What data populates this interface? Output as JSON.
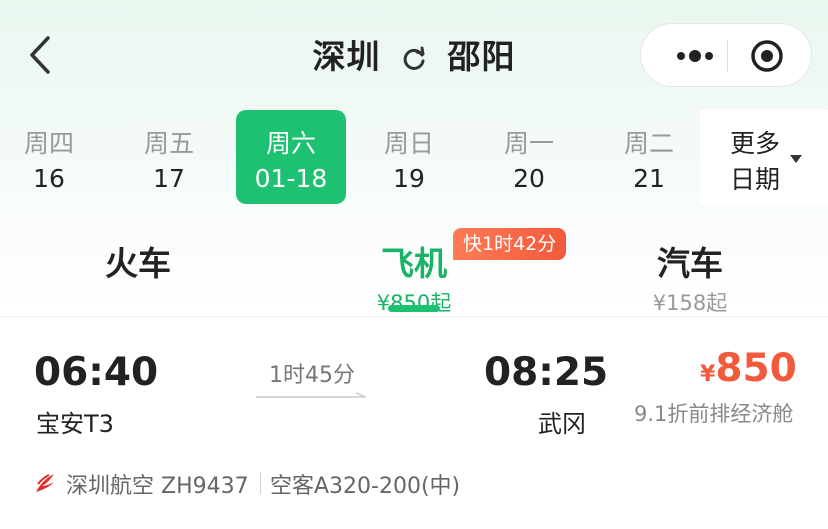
{
  "header": {
    "from_city": "深圳",
    "to_city": "邵阳"
  },
  "dates": [
    {
      "weekday": "周四",
      "day": "16",
      "active": false
    },
    {
      "weekday": "周五",
      "day": "17",
      "active": false
    },
    {
      "weekday": "周六",
      "day": "01-18",
      "active": true
    },
    {
      "weekday": "周日",
      "day": "19",
      "active": false
    },
    {
      "weekday": "周一",
      "day": "20",
      "active": false
    },
    {
      "weekday": "周二",
      "day": "21",
      "active": false
    }
  ],
  "more_dates": {
    "line1": "更多",
    "line2": "日期"
  },
  "modes": {
    "train": {
      "label": "火车"
    },
    "plane": {
      "label": "飞机",
      "price": "¥850起",
      "badge": "快1时42分"
    },
    "bus": {
      "label": "汽车",
      "price": "¥158起"
    }
  },
  "flight": {
    "dep_time": "06:40",
    "dep_airport": "宝安T3",
    "duration": "1时45分",
    "arr_time": "08:25",
    "arr_airport": "武冈",
    "currency": "¥",
    "price": "850",
    "cabin": "9.1折前排经济舱",
    "airline": "深圳航空 ZH9437",
    "aircraft": "空客A320-200(中)"
  },
  "colors": {
    "accent": "#1ec071",
    "price": "#f15a3a",
    "badge": "#f35a3c"
  },
  "icons": {
    "back": "chevron-left-icon",
    "swap": "swap-icon",
    "menu": "more-dots-icon",
    "close": "target-icon",
    "caret": "caret-down-icon",
    "airline": "shenzhen-airlines-logo-icon"
  }
}
